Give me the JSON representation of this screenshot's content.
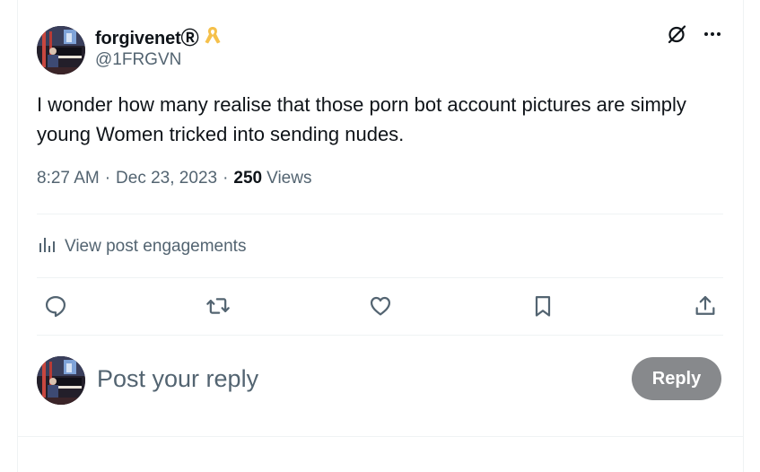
{
  "author": {
    "display_name": "forgivenetⓇ",
    "handle": "@1FRGVN",
    "avatar_icon": "pianist-avatar",
    "badge_icon": "awareness-ribbon-icon",
    "badge_color": "#f5c04a"
  },
  "post": {
    "text": "I wonder how many realise that those porn bot account pictures are simply young Women tricked into sending nudes.",
    "time": "8:27 AM",
    "date": "Dec 23, 2023",
    "separator": "·",
    "views_count": "250",
    "views_label": "Views"
  },
  "engagements": {
    "icon": "analytics-bars-icon",
    "label": "View post engagements"
  },
  "top_actions": [
    "grok-icon",
    "more-icon"
  ],
  "action_bar": [
    "reply-icon",
    "repost-icon",
    "like-icon",
    "bookmark-icon",
    "share-icon"
  ],
  "reply_box": {
    "placeholder": "Post your reply",
    "button_label": "Reply"
  },
  "colors": {
    "text_primary": "#0f1419",
    "text_secondary": "#536471",
    "divider": "#eff3f4",
    "reply_button_bg": "#87898c"
  }
}
